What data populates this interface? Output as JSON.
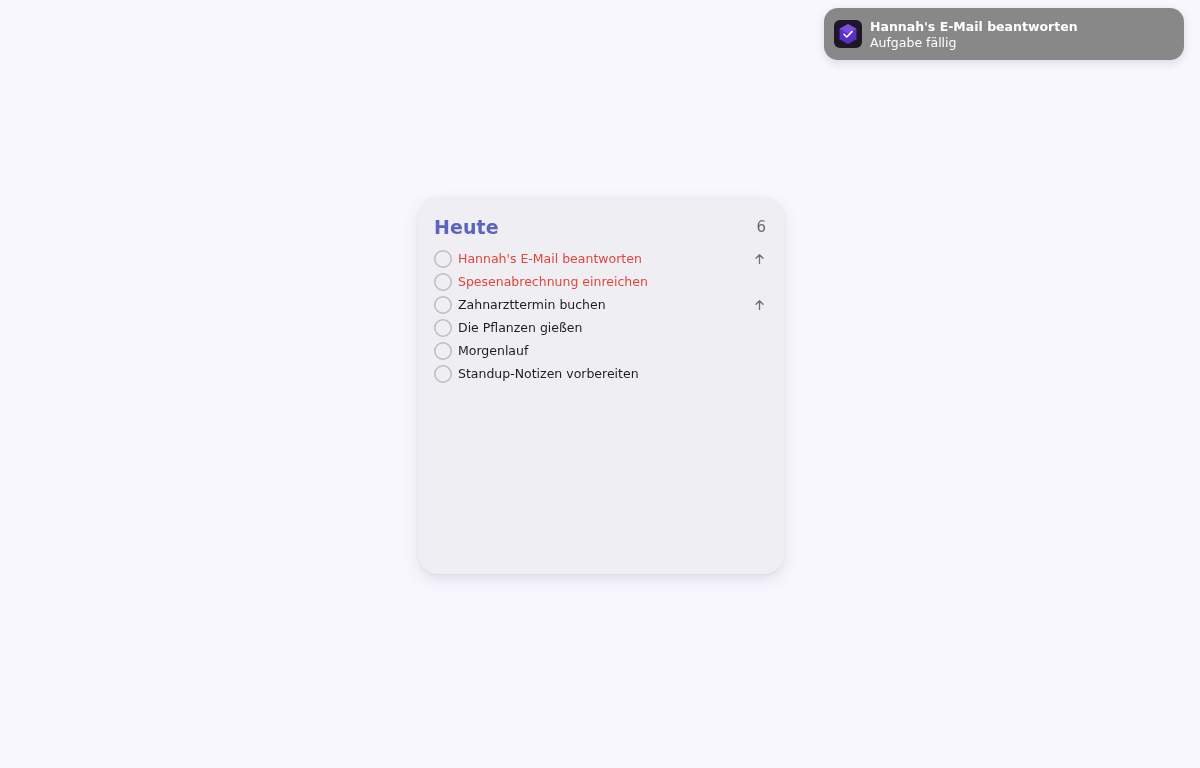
{
  "notification": {
    "title": "Hannah's E-Mail beantworten",
    "subtitle": "Aufgabe fällig"
  },
  "widget": {
    "title": "Heute",
    "count": "6",
    "tasks": [
      {
        "label": "Hannah's E-Mail beantworten",
        "checked": false,
        "overdue": true,
        "up_arrow": true
      },
      {
        "label": "Spesenabrechnung einreichen",
        "checked": false,
        "overdue": true,
        "up_arrow": false
      },
      {
        "label": "Zahnarzttermin buchen",
        "checked": false,
        "overdue": false,
        "up_arrow": true
      },
      {
        "label": "Die Pflanzen gießen",
        "checked": false,
        "overdue": false,
        "up_arrow": false
      },
      {
        "label": "Morgenlauf",
        "checked": false,
        "overdue": false,
        "up_arrow": false
      },
      {
        "label": "Standup-Notizen vorbereiten",
        "checked": false,
        "overdue": false,
        "up_arrow": false
      }
    ]
  }
}
